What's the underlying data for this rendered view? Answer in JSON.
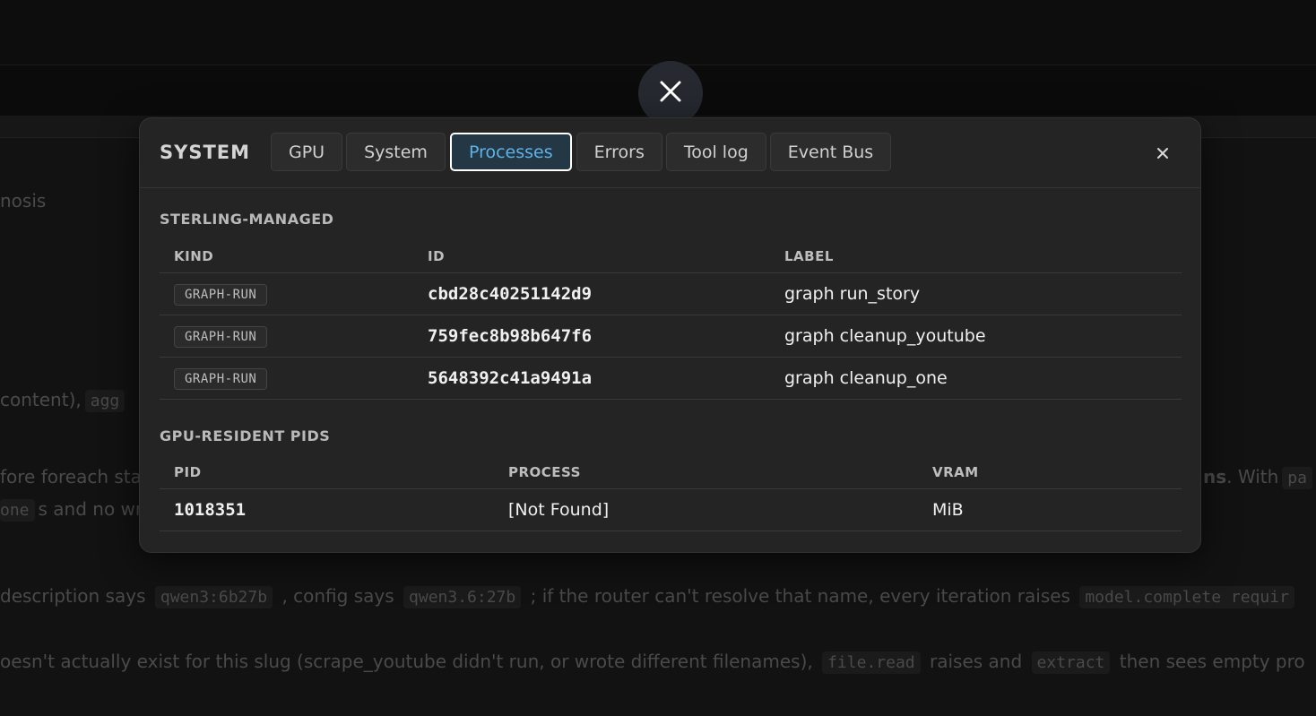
{
  "background": {
    "lines": [
      {
        "text": "nosis"
      },
      {
        "pre": "content),",
        "code": "agg"
      },
      {
        "pre": "fore foreach sta",
        "bold_right": "ns",
        "post_right": ". With",
        "code_right": "pa"
      },
      {
        "code": "one",
        "post": "s and no wr"
      },
      {
        "pre": "description says",
        "code1": "qwen3:6b27b",
        "mid1": ", config says",
        "code2": "qwen3.6:27b",
        "mid2": "; if the router can't resolve that name, every iteration raises",
        "code3": "model.complete requir"
      },
      {
        "pre": "oesn't actually exist for this slug (scrape_youtube didn't run, or wrote different filenames),",
        "code1": "file.read",
        "mid1": "raises and",
        "code2": "extract",
        "post": "then sees empty pro"
      }
    ]
  },
  "modal": {
    "title": "SYSTEM",
    "tabs": [
      "GPU",
      "System",
      "Processes",
      "Errors",
      "Tool log",
      "Event Bus"
    ],
    "active_tab": "Processes",
    "close_symbol": "×"
  },
  "sterling_managed": {
    "title": "STERLING-MANAGED",
    "columns": [
      "KIND",
      "ID",
      "LABEL"
    ],
    "rows": [
      {
        "kind": "GRAPH-RUN",
        "id": "cbd28c40251142d9",
        "label": "graph run_story"
      },
      {
        "kind": "GRAPH-RUN",
        "id": "759fec8b98b647f6",
        "label": "graph cleanup_youtube"
      },
      {
        "kind": "GRAPH-RUN",
        "id": "5648392c41a9491a",
        "label": "graph cleanup_one"
      }
    ]
  },
  "gpu_resident": {
    "title": "GPU-RESIDENT PIDS",
    "columns": [
      "PID",
      "PROCESS",
      "VRAM"
    ],
    "rows": [
      {
        "pid": "1018351",
        "process": "[Not Found]",
        "vram": "MiB"
      }
    ]
  },
  "colors": {
    "accent": "#5fb1e6",
    "modal_bg": "#242424",
    "page_bg": "#121212"
  }
}
